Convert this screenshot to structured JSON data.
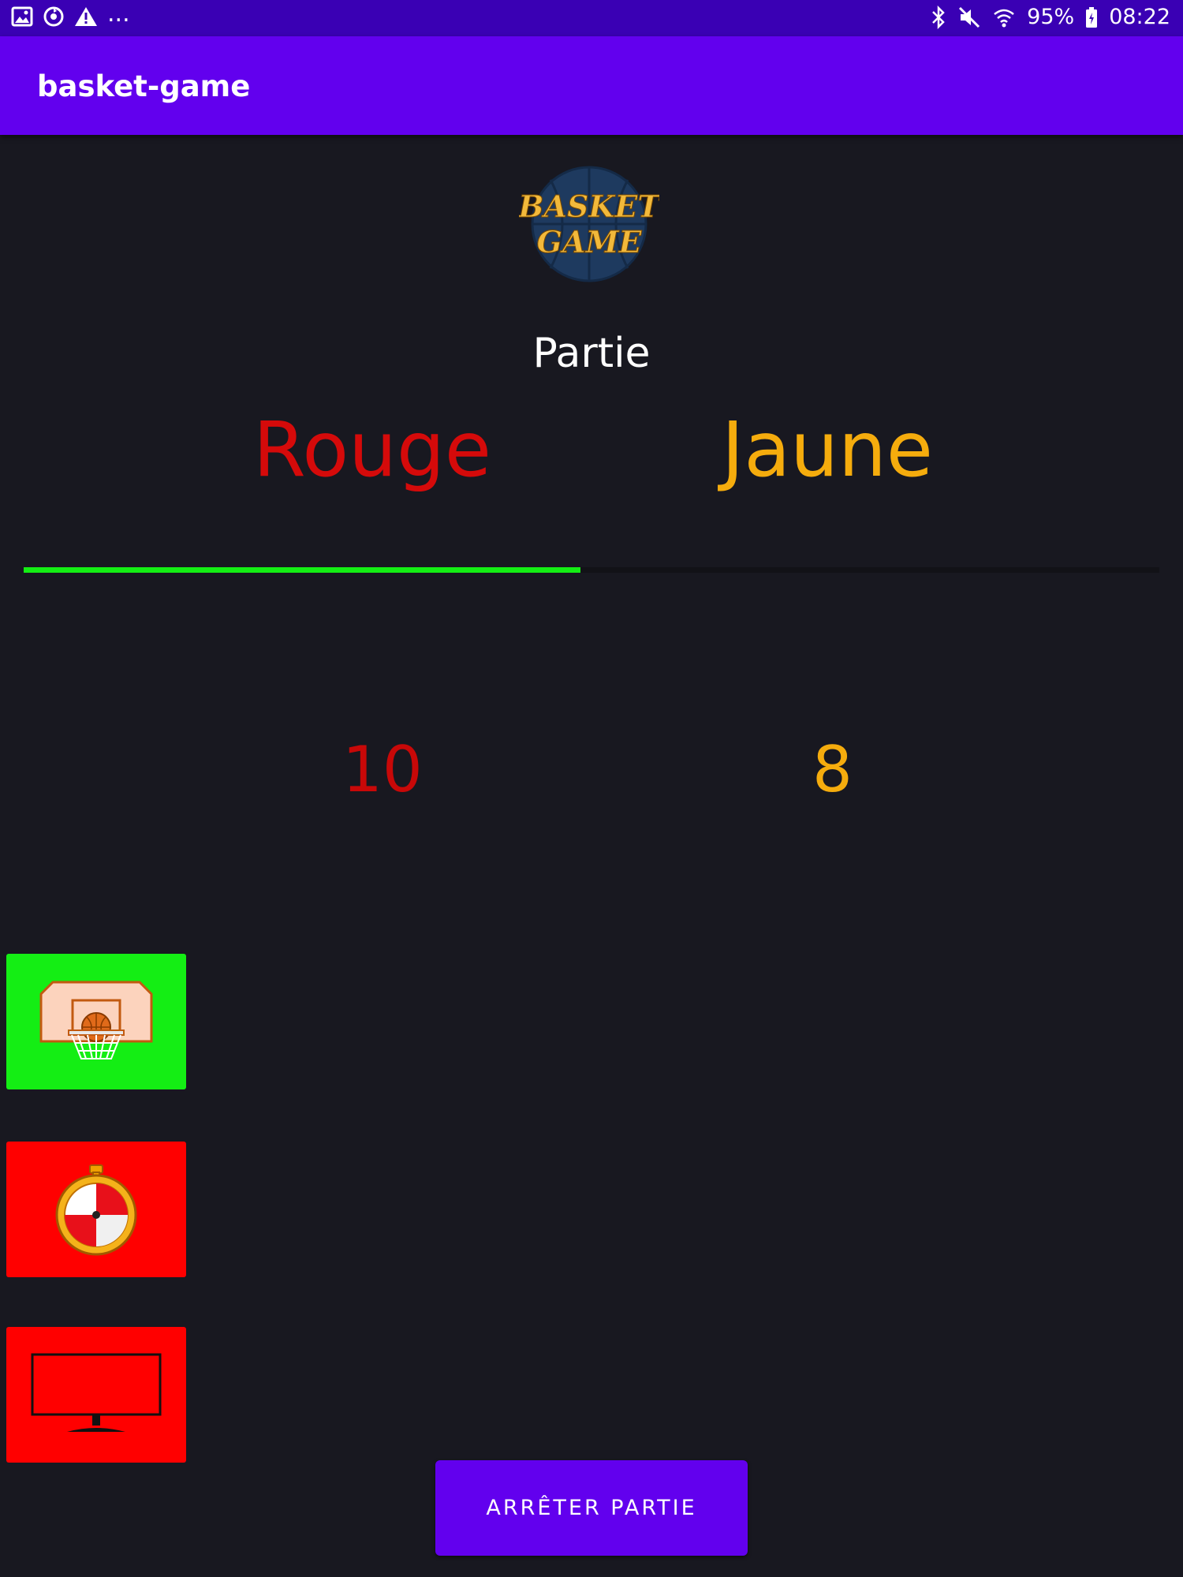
{
  "status_bar": {
    "more": "...",
    "battery": "95%",
    "time": "08:22"
  },
  "app_bar": {
    "title": "basket-game"
  },
  "logo": {
    "line1": "BASKET",
    "line2": "GAME"
  },
  "game": {
    "heading": "Partie",
    "team_red": {
      "name": "Rouge",
      "score": "10",
      "color": "#d50a0a"
    },
    "team_yellow": {
      "name": "Jaune",
      "score": "8",
      "color": "#f5ac0d"
    },
    "progress_percent": 49
  },
  "tiles": [
    {
      "icon": "basket-hoop-icon",
      "color": "#14ee14"
    },
    {
      "icon": "stopwatch-icon",
      "color": "#ff0000"
    },
    {
      "icon": "monitor-icon",
      "color": "#ff0000"
    }
  ],
  "stop_button": {
    "label": "ARRÊTER PARTIE"
  }
}
